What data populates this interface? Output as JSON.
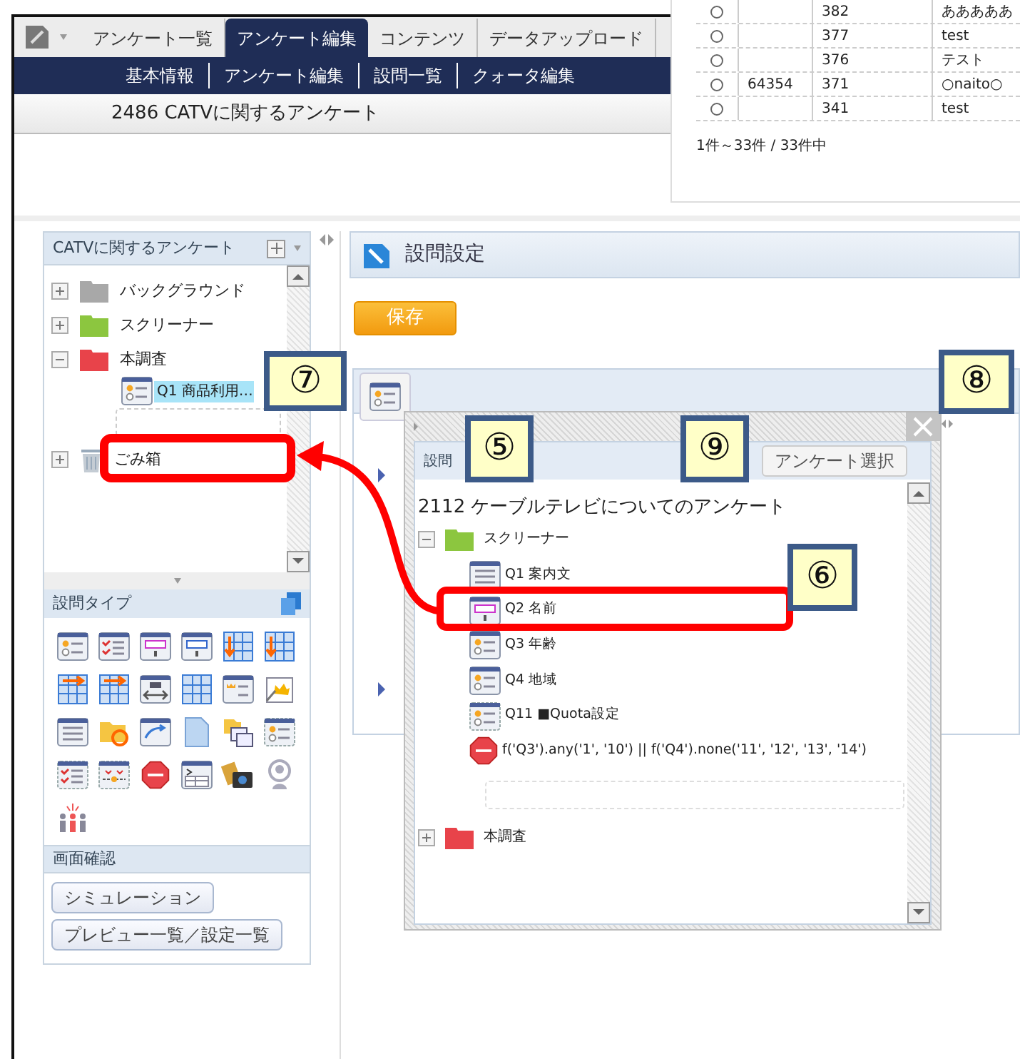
{
  "tabs": [
    {
      "label": "アンケート一覧",
      "selected": false
    },
    {
      "label": "アンケート編集",
      "selected": true
    },
    {
      "label": "コンテンツ",
      "selected": false
    },
    {
      "label": "データアップロード",
      "selected": false
    }
  ],
  "subnav": [
    "基本情報",
    "アンケート編集",
    "設問一覧",
    "クォータ編集"
  ],
  "survey_title": "2486 CATVに関するアンケート",
  "list_overlay": {
    "rows": [
      {
        "selected": false,
        "column_2": "",
        "column_3": "382",
        "column_4": "あああああ"
      },
      {
        "selected": false,
        "column_2": "",
        "column_3": "377",
        "column_4": "test"
      },
      {
        "selected": false,
        "column_2": "",
        "column_3": "376",
        "column_4": "テスト"
      },
      {
        "selected": false,
        "column_2": "64354",
        "column_3": "371",
        "column_4": "○naito○"
      },
      {
        "selected": false,
        "column_2": "",
        "column_3": "341",
        "column_4": "test"
      }
    ],
    "summary": "1件～33件 / 33件中"
  },
  "tree_panel": {
    "title": "CATVに関するアンケート",
    "items": [
      {
        "kind": "folder",
        "label": "バックグラウンド",
        "expanded": false,
        "color": "#a8a8a8"
      },
      {
        "kind": "folder",
        "label": "スクリーナー",
        "expanded": false,
        "color": "#8cc63f"
      },
      {
        "kind": "folder",
        "label": "本調査",
        "expanded": true,
        "color": "#e8434a",
        "children": [
          {
            "label": "Q1 商品利用…",
            "selected": true
          }
        ]
      },
      {
        "kind": "trash",
        "label": "ごみ箱",
        "expanded": false
      }
    ]
  },
  "question_types": {
    "title": "設問タイプ"
  },
  "screen_check": {
    "title": "画面確認",
    "buttons": [
      "シミュレーション",
      "プレビュー一覧／設定一覧"
    ]
  },
  "main": {
    "title": "設問設定",
    "save_button": "保存"
  },
  "dialog": {
    "tab": "設問",
    "select_button": "アンケート選択",
    "survey": "2112 ケーブルテレビについてのアンケート",
    "groups": [
      {
        "label": "スクリーナー",
        "expanded": true,
        "color": "#8cc63f",
        "children": [
          {
            "kind": "text",
            "label": "Q1 案内文"
          },
          {
            "kind": "freetext",
            "label": "Q2 名前"
          },
          {
            "kind": "single",
            "label": "Q3 年齢"
          },
          {
            "kind": "single",
            "label": "Q4 地域"
          },
          {
            "kind": "quota",
            "label": "Q11 ■Quota設定"
          },
          {
            "kind": "stop",
            "label": "f('Q3').any('1', '10') || f('Q4').none('11', '12', '13', '14')"
          }
        ]
      },
      {
        "label": "本調査",
        "expanded": false,
        "color": "#e8434a"
      }
    ]
  },
  "callouts": [
    "⑦",
    "⑧",
    "⑤",
    "⑨",
    "⑥"
  ]
}
